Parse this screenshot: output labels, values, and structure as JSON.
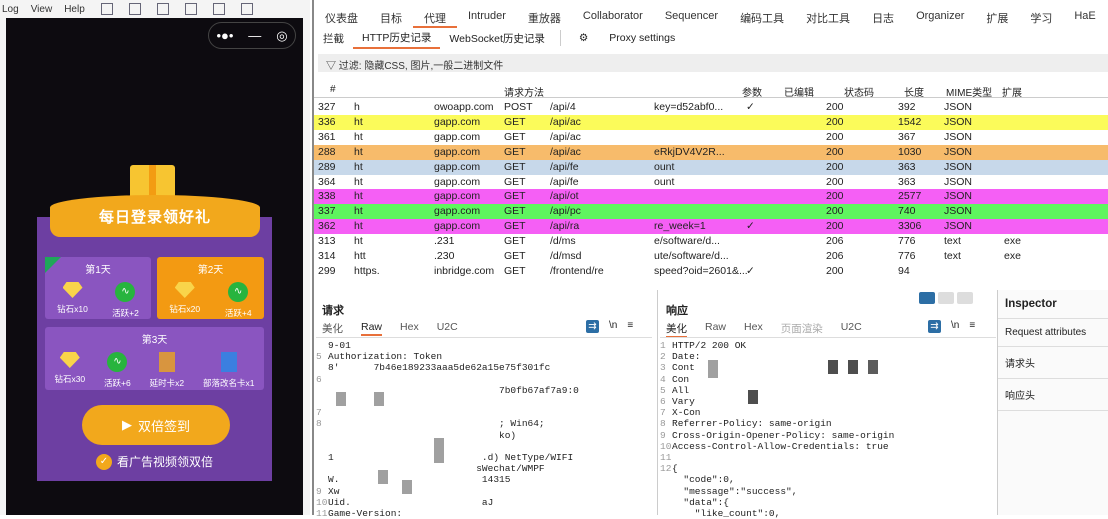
{
  "left": {
    "menu": [
      "Log",
      "View",
      "Help"
    ],
    "phone": {
      "capsule": [
        "•●•",
        "—",
        "◎"
      ],
      "banner": "每日登录领好礼",
      "days": [
        {
          "title": "第1天",
          "checked": true,
          "items": [
            {
              "icon": "diamond",
              "label": "钻石x10"
            },
            {
              "icon": "activity",
              "label": "活跃+2"
            }
          ]
        },
        {
          "title": "第2天",
          "highlight": true,
          "items": [
            {
              "icon": "diamond",
              "label": "钻石x20"
            },
            {
              "icon": "activity",
              "label": "活跃+4"
            }
          ]
        },
        {
          "title": "第3天",
          "items": [
            {
              "icon": "diamond",
              "label": "钻石x30"
            },
            {
              "icon": "activity",
              "label": "活跃+6"
            },
            {
              "icon": "hourglass-card",
              "label": "延时卡x2"
            },
            {
              "icon": "rename-card",
              "label": "部落改名卡x1"
            }
          ]
        }
      ],
      "double_button": "双倍签到",
      "ad_option": "看广告视频领双倍"
    }
  },
  "burp": {
    "tabs": [
      "仪表盘",
      "目标",
      "代理",
      "Intruder",
      "重放器",
      "Collaborator",
      "Sequencer",
      "编码工具",
      "对比工具",
      "日志",
      "Organizer",
      "扩展",
      "学习",
      "HaE"
    ],
    "active_tab": "代理",
    "subtabs": [
      "拦截",
      "HTTP历史记录",
      "WebSocket历史记录"
    ],
    "proxy_settings": "Proxy settings",
    "filter": "过滤: 隐藏CSS, 图片,一般二进制文件",
    "columns": [
      "#",
      "请求方法",
      "参数",
      "已编辑",
      "状态码",
      "长度",
      "MIME类型",
      "扩展"
    ],
    "rows": [
      {
        "id": "327",
        "host": "h",
        "host2": "owoapp.com",
        "method": "POST",
        "url": "/api/4",
        "url2": "key=d52abf0...",
        "params": "✓",
        "status": "200",
        "length": "392",
        "mime": "JSON",
        "ext": "",
        "color": "#ffffff"
      },
      {
        "id": "336",
        "host": "ht",
        "host2": "gapp.com",
        "method": "GET",
        "url": "/api/ac",
        "url2": "",
        "params": "",
        "status": "200",
        "length": "1542",
        "mime": "JSON",
        "ext": "",
        "color": "#fbfb5a"
      },
      {
        "id": "361",
        "host": "ht",
        "host2": "gapp.com",
        "method": "GET",
        "url": "/api/ac",
        "url2": "",
        "params": "",
        "status": "200",
        "length": "367",
        "mime": "JSON",
        "ext": "",
        "color": "#ffffff"
      },
      {
        "id": "288",
        "host": "ht",
        "host2": "gapp.com",
        "method": "GET",
        "url": "/api/ac",
        "url2": "eRkjDV4V2R...",
        "params": "",
        "status": "200",
        "length": "1030",
        "mime": "JSON",
        "ext": "",
        "color": "#f7bb6b"
      },
      {
        "id": "289",
        "host": "ht",
        "host2": "gapp.com",
        "method": "GET",
        "url": "/api/fe",
        "url2": "ount",
        "params": "",
        "status": "200",
        "length": "363",
        "mime": "JSON",
        "ext": "",
        "color": "#c7d8ea"
      },
      {
        "id": "364",
        "host": "ht",
        "host2": "gapp.com",
        "method": "GET",
        "url": "/api/fe",
        "url2": "ount",
        "params": "",
        "status": "200",
        "length": "363",
        "mime": "JSON",
        "ext": "",
        "color": "#ffffff"
      },
      {
        "id": "338",
        "host": "ht",
        "host2": "gapp.com",
        "method": "GET",
        "url": "/api/ot",
        "url2": "",
        "params": "",
        "status": "200",
        "length": "2577",
        "mime": "JSON",
        "ext": "",
        "color": "#f55ff5"
      },
      {
        "id": "337",
        "host": "ht",
        "host2": "gapp.com",
        "method": "GET",
        "url": "/api/pc",
        "url2": "",
        "params": "",
        "status": "200",
        "length": "740",
        "mime": "JSON",
        "ext": "",
        "color": "#5ff55f"
      },
      {
        "id": "362",
        "host": "ht",
        "host2": "gapp.com",
        "method": "GET",
        "url": "/api/ra",
        "url2": "re_week=1",
        "params": "✓",
        "status": "200",
        "length": "3306",
        "mime": "JSON",
        "ext": "",
        "color": "#f55ff5"
      },
      {
        "id": "313",
        "host": "ht",
        "host2": ".231",
        "method": "GET",
        "url": "/d/ms",
        "url2": "e/software/d...",
        "params": "",
        "status": "206",
        "length": "776",
        "mime": "text",
        "ext": "exe",
        "color": "#ffffff"
      },
      {
        "id": "314",
        "host": "htt",
        "host2": ".230",
        "method": "GET",
        "url": "/d/msd",
        "url2": "ute/software/d...",
        "params": "",
        "status": "206",
        "length": "776",
        "mime": "text",
        "ext": "exe",
        "color": "#ffffff"
      },
      {
        "id": "299",
        "host": "https.",
        "host2": "inbridge.com",
        "method": "GET",
        "url": "/frontend/re",
        "url2": "speed?oid=2601&...",
        "params": "✓",
        "status": "200",
        "length": "94",
        "mime": "",
        "ext": "",
        "color": "#ffffff"
      }
    ],
    "request": {
      "title": "请求",
      "tabs": [
        "美化",
        "Raw",
        "Hex",
        "U2C"
      ],
      "lines": [
        {
          "n": "",
          "t": "9-01"
        },
        {
          "n": "5",
          "t": "Authorization: Token"
        },
        {
          "n": "",
          "t": "8'      7b46e189233aaa5de62a15e75f301fc"
        },
        {
          "n": "6",
          "t": ""
        },
        {
          "n": "",
          "t": "                              7b0fb67af7a9:0"
        },
        {
          "n": "",
          "t": ""
        },
        {
          "n": "7",
          "t": ""
        },
        {
          "n": "8",
          "t": "                              ; Win64;"
        },
        {
          "n": "",
          "t": "                              ko)"
        },
        {
          "n": "",
          "t": ""
        },
        {
          "n": "",
          "t": "1                          .d) NetType/WIFI"
        },
        {
          "n": "",
          "t": "                          sWechat/WMPF"
        },
        {
          "n": "",
          "t": "W.                         14315"
        },
        {
          "n": "9",
          "t": "Xw"
        },
        {
          "n": "10",
          "t": "Uid.                       aJ"
        },
        {
          "n": "11",
          "t": "Game-Version:"
        }
      ]
    },
    "response": {
      "title": "响应",
      "tabs": [
        "美化",
        "Raw",
        "Hex",
        "页面渲染",
        "U2C"
      ],
      "lines": [
        {
          "n": "1",
          "t": "HTTP/2 200 OK"
        },
        {
          "n": "2",
          "t": "Date:"
        },
        {
          "n": "3",
          "t": "Cont"
        },
        {
          "n": "4",
          "t": "Con"
        },
        {
          "n": "5",
          "t": "All"
        },
        {
          "n": "6",
          "t": "Vary"
        },
        {
          "n": "7",
          "t": "X-Con"
        },
        {
          "n": "8",
          "t": "Referrer-Policy: same-origin"
        },
        {
          "n": "9",
          "t": "Cross-Origin-Opener-Policy: same-origin"
        },
        {
          "n": "10",
          "t": "Access-Control-Allow-Credentials: true"
        },
        {
          "n": "11",
          "t": ""
        },
        {
          "n": "12",
          "t": "{"
        },
        {
          "n": "",
          "t": "  \"code\":0,"
        },
        {
          "n": "",
          "t": "  \"message\":\"success\","
        },
        {
          "n": "",
          "t": "  \"data\":{"
        },
        {
          "n": "",
          "t": "    \"like_count\":0,"
        }
      ]
    },
    "inspector": {
      "title": "Inspector",
      "items": [
        "Request attributes",
        "请求头",
        "响应头"
      ]
    }
  }
}
